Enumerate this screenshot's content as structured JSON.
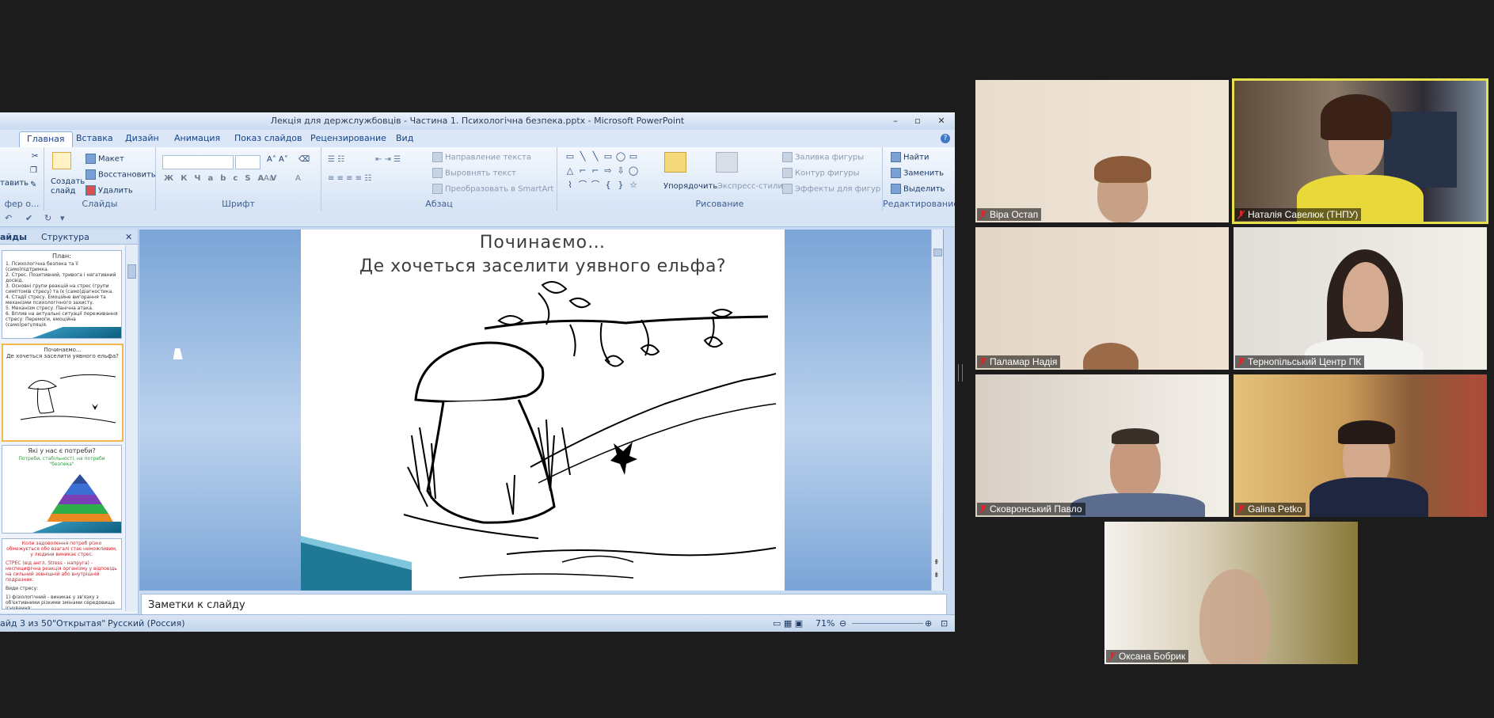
{
  "ppt": {
    "title": "Лекція для держслужбовців - Частина 1. Психологічна безпека.pptx - Microsoft PowerPoint",
    "tabs": [
      "Главная",
      "Вставка",
      "Дизайн",
      "Анимация",
      "Показ слайдов",
      "Рецензирование",
      "Вид"
    ],
    "ribbon": {
      "clipboard": {
        "paste": "тавить",
        "label": "фер о..."
      },
      "slides": {
        "new_slide": "Создать",
        "new_slide2": "слайд",
        "layout": "Макет",
        "reset": "Восстановить",
        "delete": "Удалить",
        "label": "Слайды"
      },
      "font": {
        "label": "Шрифт"
      },
      "paragraph": {
        "text_direction": "Направление текста",
        "align_text": "Выровнять текст",
        "smartart": "Преобразовать в SmartArt",
        "label": "Абзац"
      },
      "drawing": {
        "arrange": "Упорядочить",
        "quick_styles": "Экспресс-стили",
        "fill": "Заливка фигуры",
        "outline": "Контур фигуры",
        "effects": "Эффекты для фигур",
        "label": "Рисование"
      },
      "editing": {
        "find": "Найти",
        "replace": "Заменить",
        "select": "Выделить",
        "label": "Редактирование"
      }
    },
    "pane_tabs": {
      "slides": "айды",
      "outline": "Структура"
    },
    "thumbs": {
      "t1_title": "План:",
      "t1_lines": [
        "1. Психологічна безпека та її (само)підтримка.",
        "2. Стрес. Позитивний, тривога і негативний досвід.",
        "3. Основні групи реакцій на стрес (групи симптомів стресу) та їх (само)діагностика.",
        "4. Стадії стресу. Емоційне вигорання та механізми психологічного захисту.",
        "5. Механізм стресу. Панічна атака.",
        "6. Вплив на актуальні ситуації переживання стресу. Перемоги, емоційна (само)регуляція.",
        "7. Когнітивні аспекти психологічної (само)допомоги."
      ],
      "t2_title": "Починаємо...",
      "t2_sub": "Де хочеться заселити уявного ельфа?",
      "t3_title": "Які у нас є потреби?",
      "t3_sub": "Потреби, стабільності, на потреби \"безпека\"",
      "t4_line1": "Коли задоволення потреб різко обмежується обо взагалі стає неможливим, у людини виникає стрес.",
      "t4_line2": "СТРЕС (від англ. Stress - напруга) - неспецифічна реакція організму у відповідь на сильний зовнішній або внутрішній подразник.",
      "t4_line3": "Види стресу:",
      "t4_line4": "1) фізіологічний - виникає у зв'язку з об'єктивними різкими змінами середовища існування;"
    },
    "slide": {
      "line1": "Починаємо…",
      "line2": "Де хочеться заселити уявного ельфа?"
    },
    "notes_placeholder": "Заметки к слайду",
    "status": {
      "slide_counter": "айд 3 из 50",
      "theme": "\"Открытая\"",
      "language": "Русский (Россия)",
      "zoom": "71%"
    }
  },
  "participants": [
    {
      "name": "Віра Остап",
      "active": false
    },
    {
      "name": "Наталія Савелюк (ТНПУ)",
      "active": true
    },
    {
      "name": "Паламар Надія",
      "active": false
    },
    {
      "name": "Тернопільський Центр ПК",
      "active": false
    },
    {
      "name": "Сковронський Павло",
      "active": false
    },
    {
      "name": "Galina Petko",
      "active": false
    },
    {
      "name": "Оксана Бобрик",
      "active": false
    }
  ],
  "colors": {
    "active_speaker_border": "#e7e04c",
    "muted_icon": "#d9262c",
    "background": "#1c1c1c"
  }
}
